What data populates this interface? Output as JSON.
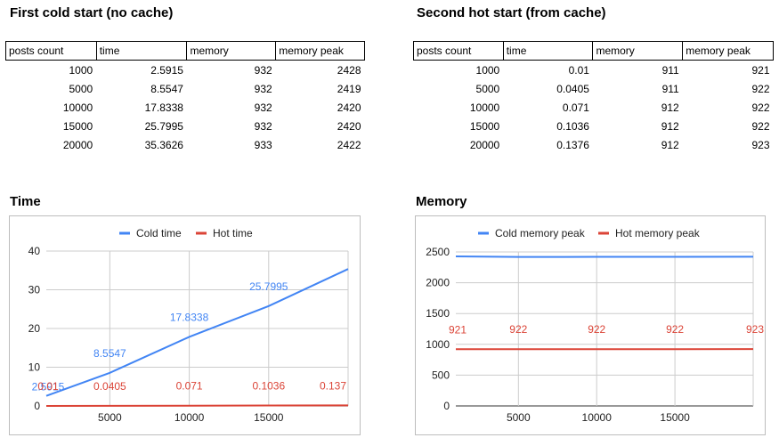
{
  "tables": [
    {
      "title": "First cold start (no cache)",
      "headers": [
        "posts count",
        "time",
        "memory",
        "memory peak"
      ],
      "rows": [
        [
          "1000",
          "2.5915",
          "932",
          "2428"
        ],
        [
          "5000",
          "8.5547",
          "932",
          "2419"
        ],
        [
          "10000",
          "17.8338",
          "932",
          "2420"
        ],
        [
          "15000",
          "25.7995",
          "932",
          "2420"
        ],
        [
          "20000",
          "35.3626",
          "933",
          "2422"
        ]
      ]
    },
    {
      "title": "Second hot start (from cache)",
      "headers": [
        "posts count",
        "time",
        "memory",
        "memory peak"
      ],
      "rows": [
        [
          "1000",
          "0.01",
          "911",
          "921"
        ],
        [
          "5000",
          "0.0405",
          "911",
          "922"
        ],
        [
          "10000",
          "0.071",
          "912",
          "922"
        ],
        [
          "15000",
          "0.1036",
          "912",
          "922"
        ],
        [
          "20000",
          "0.1376",
          "912",
          "923"
        ]
      ]
    }
  ],
  "chart_data": [
    {
      "type": "line",
      "title": "Time",
      "x": [
        1000,
        5000,
        10000,
        15000,
        20000
      ],
      "xticks": [
        5000,
        10000,
        15000
      ],
      "xlim": [
        1000,
        20000
      ],
      "yticks": [
        0,
        10,
        20,
        30,
        40
      ],
      "ylim": [
        0,
        40
      ],
      "grid": true,
      "legend_position": "top",
      "series": [
        {
          "name": "Cold time",
          "color": "#4285F4",
          "values": [
            2.5915,
            8.5547,
            17.8338,
            25.7995,
            35.3626
          ],
          "data_labels": [
            "2.5915",
            "8.5547",
            "17.8338",
            "25.7995"
          ]
        },
        {
          "name": "Hot time",
          "color": "#DB4437",
          "values": [
            0.01,
            0.0405,
            0.071,
            0.1036,
            0.1376
          ],
          "data_labels": [
            "0.01",
            "0.0405",
            "0.071",
            "0.1036",
            "0.137"
          ]
        }
      ]
    },
    {
      "type": "line",
      "title": "Memory",
      "x": [
        1000,
        5000,
        10000,
        15000,
        20000
      ],
      "xticks": [
        5000,
        10000,
        15000
      ],
      "xlim": [
        1000,
        20000
      ],
      "yticks": [
        0,
        500,
        1000,
        1500,
        2000,
        2500
      ],
      "ylim": [
        0,
        2500
      ],
      "grid": true,
      "legend_position": "top",
      "series": [
        {
          "name": "Cold memory peak",
          "color": "#4285F4",
          "values": [
            2428,
            2419,
            2420,
            2420,
            2422
          ],
          "data_labels": []
        },
        {
          "name": "Hot memory peak",
          "color": "#DB4437",
          "values": [
            921,
            922,
            922,
            922,
            923
          ],
          "data_labels": [
            "921",
            "922",
            "922",
            "922",
            "923"
          ]
        }
      ]
    }
  ]
}
